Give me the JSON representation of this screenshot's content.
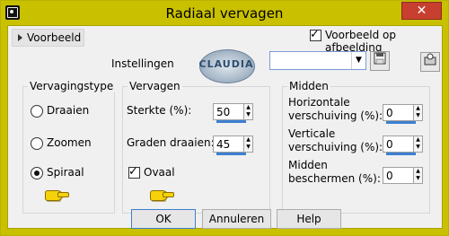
{
  "window": {
    "title": "Radiaal vervagen",
    "close_glyph": "✕"
  },
  "toolbar": {
    "preview_toggle_label": "Voorbeeld",
    "preview_checkbox_label": "Voorbeeld op afbeelding",
    "preview_checked": true,
    "settings_label": "Instellingen",
    "settings_value": "",
    "save_icon": "save-icon",
    "preset_icon": "preset-icon"
  },
  "watermark": {
    "text": "CLAUDIA"
  },
  "groups": {
    "type": {
      "title": "Vervagingstype",
      "options": [
        {
          "label": "Draaien",
          "selected": false
        },
        {
          "label": "Zoomen",
          "selected": false
        },
        {
          "label": "Spiraal",
          "selected": true
        }
      ]
    },
    "blur": {
      "title": "Vervagen",
      "strength_label": "Sterkte (%):",
      "strength_value": "50",
      "rotation_label": "Graden draaien:",
      "rotation_value": "45",
      "oval_label": "Ovaal",
      "oval_checked": true
    },
    "center": {
      "title": "Midden",
      "hshift_label_line1": "Horizontale",
      "hshift_label_line2": "verschuiving (%):",
      "hshift_value": "0",
      "vshift_label_line1": "Verticale",
      "vshift_label_line2": "verschuiving (%):",
      "vshift_value": "0",
      "protect_label_line1": "Midden",
      "protect_label_line2": "beschermen (%):",
      "protect_value": "0"
    }
  },
  "buttons": {
    "ok": "OK",
    "cancel": "Annuleren",
    "help": "Help"
  },
  "colors": {
    "titlebar": "#c9c000",
    "close": "#c7402f",
    "accent": "#3c7fd1",
    "pointer": "#f6d20a"
  }
}
